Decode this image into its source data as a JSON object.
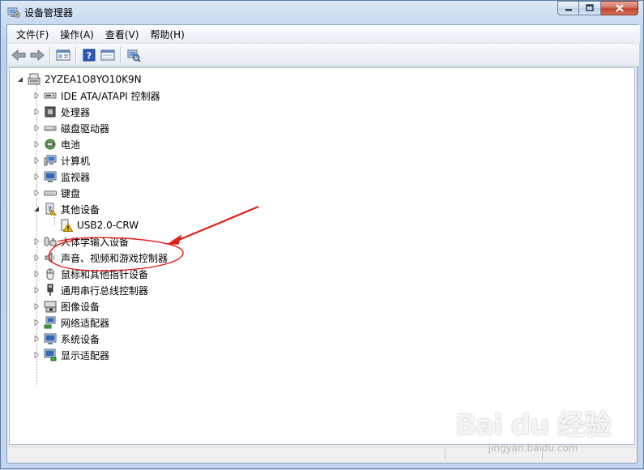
{
  "window": {
    "title": "设备管理器"
  },
  "menu": [
    "文件(F)",
    "操作(A)",
    "查看(V)",
    "帮助(H)"
  ],
  "toolbar": [
    "back-icon",
    "forward-icon",
    "properties-icon",
    "help-icon",
    "show-hidden-icon",
    "scan-hardware-icon"
  ],
  "tree": {
    "root": "2YZEA1O8YO10K9N",
    "items": [
      {
        "label": "IDE ATA/ATAPI 控制器",
        "icon": "ide-controller-icon",
        "expanded": false
      },
      {
        "label": "处理器",
        "icon": "processor-icon",
        "expanded": false
      },
      {
        "label": "磁盘驱动器",
        "icon": "disk-drive-icon",
        "expanded": false
      },
      {
        "label": "电池",
        "icon": "battery-icon",
        "expanded": false
      },
      {
        "label": "计算机",
        "icon": "computer-icon",
        "expanded": false
      },
      {
        "label": "监视器",
        "icon": "monitor-icon",
        "expanded": false
      },
      {
        "label": "键盘",
        "icon": "keyboard-icon",
        "expanded": false
      },
      {
        "label": "其他设备",
        "icon": "other-devices-icon",
        "expanded": true
      },
      {
        "label": "USB2.0-CRW",
        "icon": "warning-device-icon",
        "child": true
      },
      {
        "label": "人体学输入设备",
        "icon": "hid-icon",
        "expanded": false
      },
      {
        "label": "声音、视频和游戏控制器",
        "icon": "sound-icon",
        "expanded": false,
        "highlighted": true
      },
      {
        "label": "鼠标和其他指针设备",
        "icon": "mouse-icon",
        "expanded": false
      },
      {
        "label": "通用串行总线控制器",
        "icon": "usb-icon",
        "expanded": false
      },
      {
        "label": "图像设备",
        "icon": "imaging-icon",
        "expanded": false
      },
      {
        "label": "网络适配器",
        "icon": "network-icon",
        "expanded": false
      },
      {
        "label": "系统设备",
        "icon": "system-device-icon",
        "expanded": false
      },
      {
        "label": "显示适配器",
        "icon": "display-adapter-icon",
        "expanded": false
      }
    ]
  },
  "annotation_color": "#e0201a",
  "watermark": {
    "logo": "Bai du 经验",
    "url": "jingyan.baidu.com"
  }
}
